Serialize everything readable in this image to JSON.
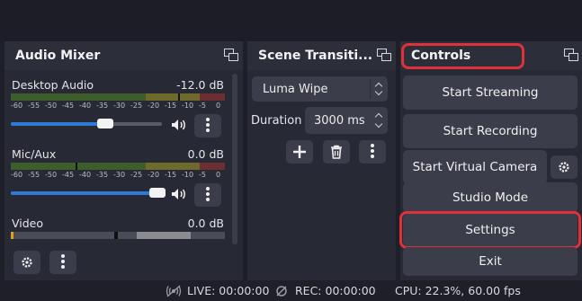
{
  "audio_mixer": {
    "title": "Audio Mixer",
    "meter_ticks": [
      "-60",
      "-55",
      "-50",
      "-45",
      "-40",
      "-35",
      "-30",
      "-25",
      "-20",
      "-15",
      "-10",
      "-5",
      "0"
    ],
    "channels": [
      {
        "name": "Desktop Audio",
        "level": "-12.0 dB",
        "volume_fraction": 0.44,
        "meter_level_fraction": 0.78
      },
      {
        "name": "Mic/Aux",
        "level": "0.0 dB",
        "volume_fraction": 0.7,
        "meter_level_fraction": 0.3
      },
      {
        "name": "Video",
        "level": "0.0 dB"
      }
    ]
  },
  "scene_transitions": {
    "title": "Scene Transiti...",
    "transition": "Luma Wipe",
    "duration_label": "Duration",
    "duration_value": "3000 ms"
  },
  "controls": {
    "title": "Controls",
    "buttons": {
      "start_streaming": "Start Streaming",
      "start_recording": "Start Recording",
      "start_virtual_camera": "Start Virtual Camera",
      "studio_mode": "Studio Mode",
      "settings": "Settings",
      "exit": "Exit"
    }
  },
  "status_bar": {
    "live": "LIVE: 00:00:00",
    "rec": "REC: 00:00:00",
    "cpu": "CPU: 22.3%, 60.00 fps"
  },
  "colors": {
    "highlight": "#e0313a",
    "slider_accent": "#2f7ad8",
    "panel_bg": "#272934",
    "button_bg": "#3b3d4a"
  },
  "icons": [
    "float-dock-icon",
    "speaker-icon",
    "kebab-menu-icon",
    "plus-icon",
    "trash-icon",
    "gear-icon",
    "live-icon",
    "rec-icon"
  ]
}
